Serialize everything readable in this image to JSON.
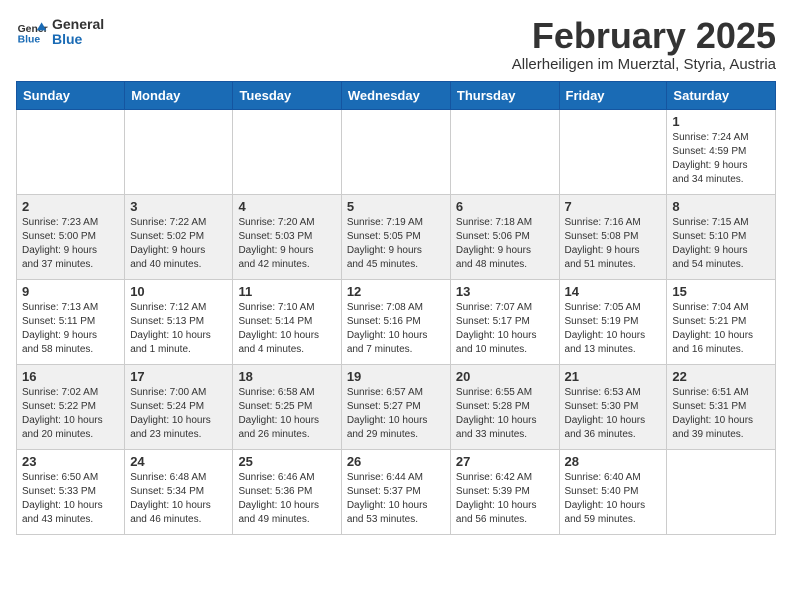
{
  "logo": {
    "general": "General",
    "blue": "Blue"
  },
  "header": {
    "month": "February 2025",
    "location": "Allerheiligen im Muerztal, Styria, Austria"
  },
  "weekdays": [
    "Sunday",
    "Monday",
    "Tuesday",
    "Wednesday",
    "Thursday",
    "Friday",
    "Saturday"
  ],
  "weeks": [
    [
      {
        "day": "",
        "info": ""
      },
      {
        "day": "",
        "info": ""
      },
      {
        "day": "",
        "info": ""
      },
      {
        "day": "",
        "info": ""
      },
      {
        "day": "",
        "info": ""
      },
      {
        "day": "",
        "info": ""
      },
      {
        "day": "1",
        "info": "Sunrise: 7:24 AM\nSunset: 4:59 PM\nDaylight: 9 hours\nand 34 minutes."
      }
    ],
    [
      {
        "day": "2",
        "info": "Sunrise: 7:23 AM\nSunset: 5:00 PM\nDaylight: 9 hours\nand 37 minutes."
      },
      {
        "day": "3",
        "info": "Sunrise: 7:22 AM\nSunset: 5:02 PM\nDaylight: 9 hours\nand 40 minutes."
      },
      {
        "day": "4",
        "info": "Sunrise: 7:20 AM\nSunset: 5:03 PM\nDaylight: 9 hours\nand 42 minutes."
      },
      {
        "day": "5",
        "info": "Sunrise: 7:19 AM\nSunset: 5:05 PM\nDaylight: 9 hours\nand 45 minutes."
      },
      {
        "day": "6",
        "info": "Sunrise: 7:18 AM\nSunset: 5:06 PM\nDaylight: 9 hours\nand 48 minutes."
      },
      {
        "day": "7",
        "info": "Sunrise: 7:16 AM\nSunset: 5:08 PM\nDaylight: 9 hours\nand 51 minutes."
      },
      {
        "day": "8",
        "info": "Sunrise: 7:15 AM\nSunset: 5:10 PM\nDaylight: 9 hours\nand 54 minutes."
      }
    ],
    [
      {
        "day": "9",
        "info": "Sunrise: 7:13 AM\nSunset: 5:11 PM\nDaylight: 9 hours\nand 58 minutes."
      },
      {
        "day": "10",
        "info": "Sunrise: 7:12 AM\nSunset: 5:13 PM\nDaylight: 10 hours\nand 1 minute."
      },
      {
        "day": "11",
        "info": "Sunrise: 7:10 AM\nSunset: 5:14 PM\nDaylight: 10 hours\nand 4 minutes."
      },
      {
        "day": "12",
        "info": "Sunrise: 7:08 AM\nSunset: 5:16 PM\nDaylight: 10 hours\nand 7 minutes."
      },
      {
        "day": "13",
        "info": "Sunrise: 7:07 AM\nSunset: 5:17 PM\nDaylight: 10 hours\nand 10 minutes."
      },
      {
        "day": "14",
        "info": "Sunrise: 7:05 AM\nSunset: 5:19 PM\nDaylight: 10 hours\nand 13 minutes."
      },
      {
        "day": "15",
        "info": "Sunrise: 7:04 AM\nSunset: 5:21 PM\nDaylight: 10 hours\nand 16 minutes."
      }
    ],
    [
      {
        "day": "16",
        "info": "Sunrise: 7:02 AM\nSunset: 5:22 PM\nDaylight: 10 hours\nand 20 minutes."
      },
      {
        "day": "17",
        "info": "Sunrise: 7:00 AM\nSunset: 5:24 PM\nDaylight: 10 hours\nand 23 minutes."
      },
      {
        "day": "18",
        "info": "Sunrise: 6:58 AM\nSunset: 5:25 PM\nDaylight: 10 hours\nand 26 minutes."
      },
      {
        "day": "19",
        "info": "Sunrise: 6:57 AM\nSunset: 5:27 PM\nDaylight: 10 hours\nand 29 minutes."
      },
      {
        "day": "20",
        "info": "Sunrise: 6:55 AM\nSunset: 5:28 PM\nDaylight: 10 hours\nand 33 minutes."
      },
      {
        "day": "21",
        "info": "Sunrise: 6:53 AM\nSunset: 5:30 PM\nDaylight: 10 hours\nand 36 minutes."
      },
      {
        "day": "22",
        "info": "Sunrise: 6:51 AM\nSunset: 5:31 PM\nDaylight: 10 hours\nand 39 minutes."
      }
    ],
    [
      {
        "day": "23",
        "info": "Sunrise: 6:50 AM\nSunset: 5:33 PM\nDaylight: 10 hours\nand 43 minutes."
      },
      {
        "day": "24",
        "info": "Sunrise: 6:48 AM\nSunset: 5:34 PM\nDaylight: 10 hours\nand 46 minutes."
      },
      {
        "day": "25",
        "info": "Sunrise: 6:46 AM\nSunset: 5:36 PM\nDaylight: 10 hours\nand 49 minutes."
      },
      {
        "day": "26",
        "info": "Sunrise: 6:44 AM\nSunset: 5:37 PM\nDaylight: 10 hours\nand 53 minutes."
      },
      {
        "day": "27",
        "info": "Sunrise: 6:42 AM\nSunset: 5:39 PM\nDaylight: 10 hours\nand 56 minutes."
      },
      {
        "day": "28",
        "info": "Sunrise: 6:40 AM\nSunset: 5:40 PM\nDaylight: 10 hours\nand 59 minutes."
      },
      {
        "day": "",
        "info": ""
      }
    ]
  ]
}
